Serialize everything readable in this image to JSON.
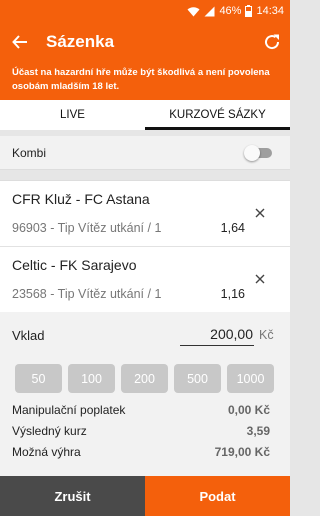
{
  "status_bar": {
    "battery": "46%",
    "time": "14:34"
  },
  "app_bar": {
    "title": "Sázenka",
    "icons": [
      "back-arrow",
      "refresh"
    ]
  },
  "warning": "Účast na hazardní hře může být škodlivá a není povolena osobám mladším 18 let.",
  "tabs": [
    {
      "label": "LIVE",
      "active": false
    },
    {
      "label": "KURZOVÉ SÁZKY",
      "active": true
    }
  ],
  "kombi": {
    "label": "Kombi",
    "enabled": false
  },
  "bets": [
    {
      "match": "CFR Kluž - FC Astana",
      "tip": "96903 - Tip Vítěz utkání / 1",
      "odds": "1,64"
    },
    {
      "match": "Celtic - FK Sarajevo",
      "tip": "23568 - Tip Vítěz utkání / 1",
      "odds": "1,16"
    }
  ],
  "stake": {
    "label": "Vklad",
    "value": "200,00",
    "currency": "Kč"
  },
  "quick_amounts": [
    "50",
    "100",
    "200",
    "500",
    "1000"
  ],
  "summary": [
    {
      "label": "Manipulační poplatek",
      "value": "0,00 Kč"
    },
    {
      "label": "Výsledný kurz",
      "value": "3,59"
    },
    {
      "label": "Možná výhra",
      "value": "719,00 Kč"
    }
  ],
  "footer": {
    "cancel_label": "Zrušit",
    "submit_label": "Podat"
  },
  "colors": {
    "accent": "#f4600c",
    "cancel": "#4a4a4a",
    "quick_button": "#c8c8c8"
  }
}
